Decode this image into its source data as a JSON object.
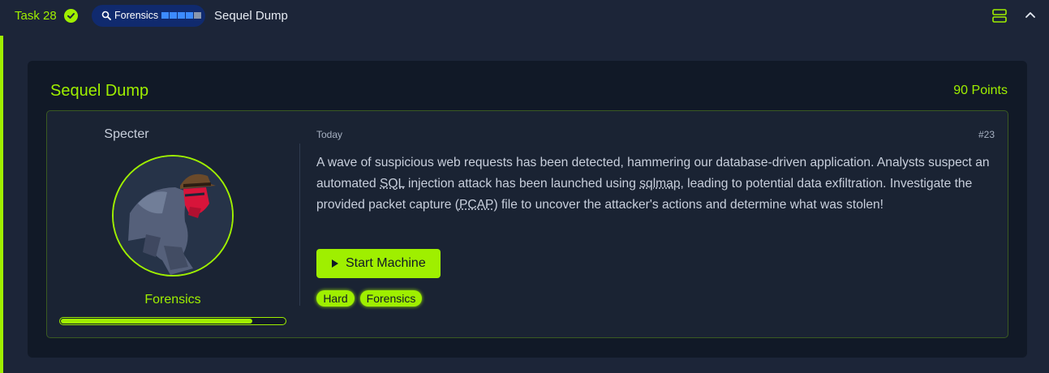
{
  "header": {
    "task_label": "Task 28",
    "task_completed": true,
    "category_label": "Forensics",
    "difficulty_level": 4,
    "difficulty_max": 5,
    "title": "Sequel Dump",
    "icons": [
      "check-circle-icon",
      "search-icon",
      "menu-icon",
      "chevron-up-icon"
    ]
  },
  "challenge": {
    "title": "Sequel Dump",
    "points": "90 Points",
    "author": "Specter",
    "category": "Forensics",
    "category_progress": 0.85,
    "date": "Today",
    "number": "#23",
    "description": {
      "p1": "A wave of suspicious web requests has been detected, hammering our database-driven application. Analysts suspect an automated ",
      "abbr1": "SQL",
      "p2": " injection attack has been launched using ",
      "abbr2": "sqlmap",
      "p3": ", leading to potential data exfiltration. Investigate the provided packet capture (",
      "abbr3": "PCAP",
      "p4": ") file to uncover the attacker's actions and determine what was stolen!"
    },
    "start_button": "Start Machine",
    "tags": [
      "Hard",
      "Forensics"
    ]
  },
  "colors": {
    "accent": "#9fef00",
    "background": "#1c2538",
    "card": "#111927",
    "pill": "#102a6e"
  }
}
